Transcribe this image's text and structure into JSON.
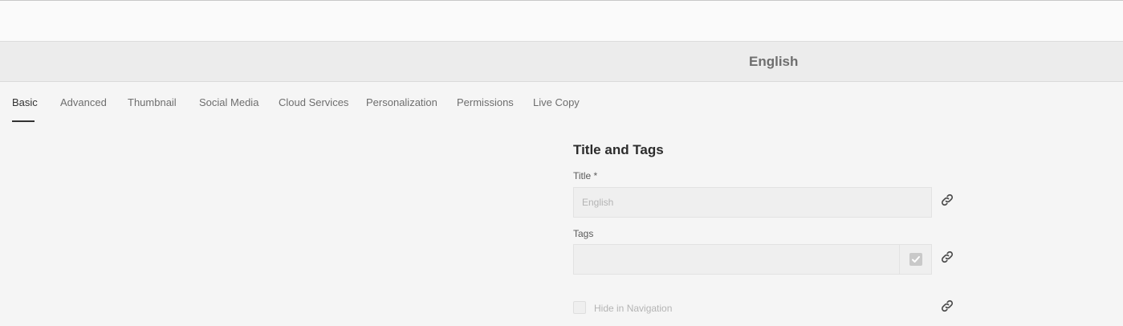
{
  "header": {
    "page_title": "English"
  },
  "tabs": [
    {
      "label": "Basic",
      "active": true
    },
    {
      "label": "Advanced"
    },
    {
      "label": "Thumbnail"
    },
    {
      "label": "Social Media"
    },
    {
      "label": "Cloud Services"
    },
    {
      "label": "Personalization"
    },
    {
      "label": "Permissions"
    },
    {
      "label": "Live Copy"
    }
  ],
  "form": {
    "section_title": "Title and Tags",
    "title": {
      "label": "Title *",
      "placeholder": "English",
      "value": ""
    },
    "tags": {
      "label": "Tags",
      "value": ""
    },
    "hide_in_navigation": {
      "label": "Hide in Navigation",
      "checked": false
    }
  },
  "colors": {
    "background": "#f5f5f5",
    "titlebar": "#ececec",
    "active_tab_underline": "#323232"
  },
  "icons": {
    "inheritance_link": "link-icon",
    "tag_picker": "checkmark-icon"
  }
}
